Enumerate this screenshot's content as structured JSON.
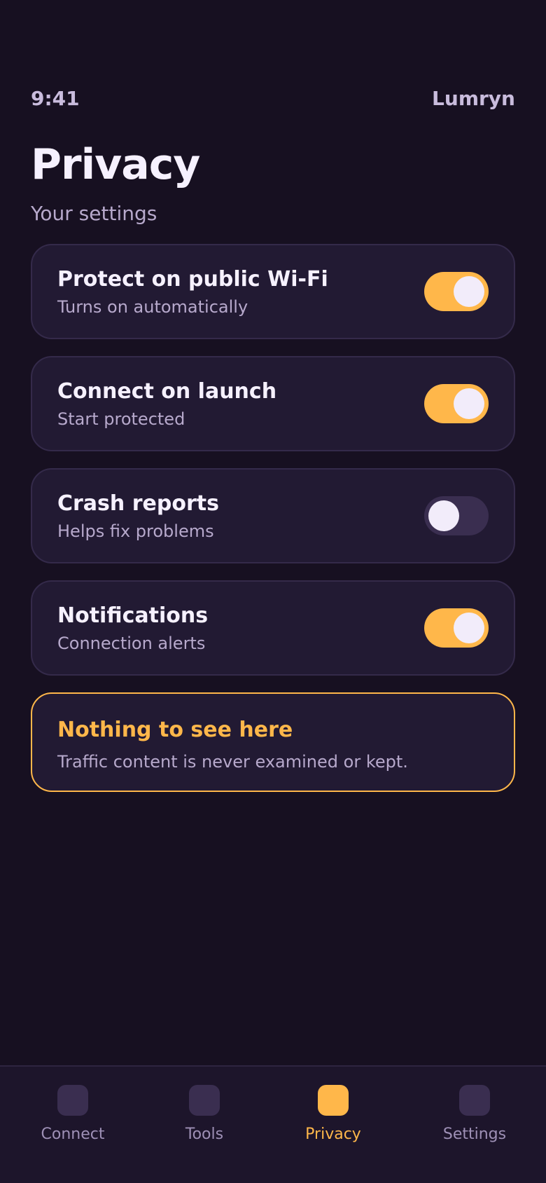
{
  "status": {
    "time": "9:41",
    "brand": "Lumryn"
  },
  "header": {
    "title": "Privacy",
    "subtitle": "Your settings"
  },
  "settings": [
    {
      "title": "Protect on public Wi-Fi",
      "subtitle": "Turns on automatically",
      "enabled": true
    },
    {
      "title": "Connect on launch",
      "subtitle": "Start protected",
      "enabled": true
    },
    {
      "title": "Crash reports",
      "subtitle": "Helps fix problems",
      "enabled": false
    },
    {
      "title": "Notifications",
      "subtitle": "Connection alerts",
      "enabled": true
    }
  ],
  "notice": {
    "title": "Nothing to see here",
    "body": "Traffic content is never examined or kept."
  },
  "tabs": [
    {
      "label": "Connect",
      "active": false
    },
    {
      "label": "Tools",
      "active": false
    },
    {
      "label": "Privacy",
      "active": true
    },
    {
      "label": "Settings",
      "active": false
    }
  ],
  "colors": {
    "background": "#171021",
    "card": "#221a33",
    "accent": "#ffb74a",
    "toggle_off": "#3a2e50",
    "muted_text": "#b7a9cc"
  }
}
